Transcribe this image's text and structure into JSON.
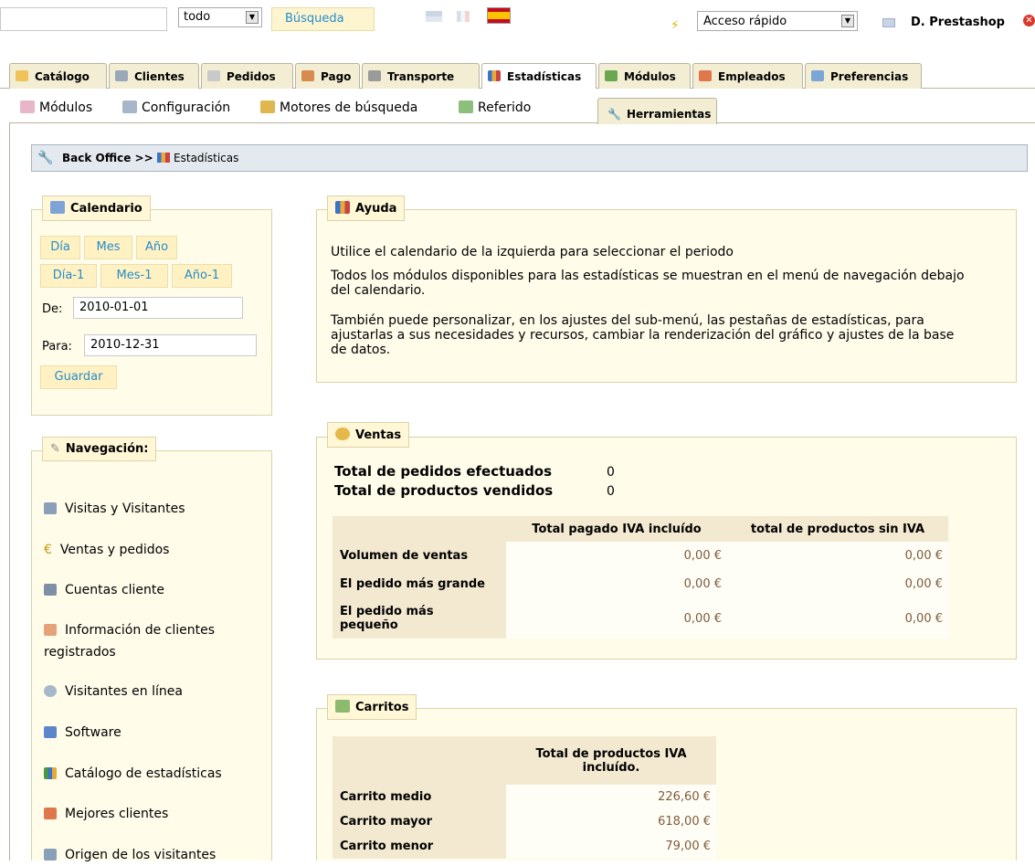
{
  "topbar": {
    "search_value": "",
    "search_scope": "todo",
    "search_button": "Búsqueda",
    "quick_access": "Acceso rápido",
    "user_name": "D. Prestashop"
  },
  "tabs": [
    {
      "label": "Catálogo"
    },
    {
      "label": "Clientes"
    },
    {
      "label": "Pedidos"
    },
    {
      "label": "Pago"
    },
    {
      "label": "Transporte"
    },
    {
      "label": "Estadísticas"
    },
    {
      "label": "Módulos"
    },
    {
      "label": "Empleados"
    },
    {
      "label": "Preferencias"
    },
    {
      "label": "Herramientas"
    }
  ],
  "subnav": [
    {
      "label": "Módulos"
    },
    {
      "label": "Configuración"
    },
    {
      "label": "Motores de búsqueda"
    },
    {
      "label": "Referido"
    }
  ],
  "breadcrumb": {
    "root": "Back Office",
    "sep": ">>",
    "current": "Estadísticas"
  },
  "calendar": {
    "legend": "Calendario",
    "buttons": [
      "Día",
      "Mes",
      "Año",
      "Día-1",
      "Mes-1",
      "Año-1"
    ],
    "from_label": "De:",
    "from_value": "2010-01-01",
    "to_label": "Para:",
    "to_value": "2010-12-31",
    "save": "Guardar"
  },
  "navigation": {
    "legend": "Navegación:",
    "items": [
      "Visitas y Visitantes",
      "Ventas y pedidos",
      "Cuentas cliente",
      "Información de clientes registrados",
      "Visitantes en línea",
      "Software",
      "Catálogo de estadísticas",
      "Mejores clientes",
      "Origen de los visitantes"
    ]
  },
  "help": {
    "legend": "Ayuda",
    "p1": "Utilice el calendario de la izquierda para seleccionar el periodo",
    "p2": "Todos los módulos disponibles para las estadísticas se muestran en el menú de navegación debajo del calendario.",
    "p3": "También puede personalizar, en los ajustes del sub-menú, las pestañas de estadísticas, para ajustarlas a sus necesidades y recursos, cambiar la renderización del gráfico y ajustes de la base de datos."
  },
  "sales": {
    "legend": "Ventas",
    "orders_label": "Total de pedidos efectuados",
    "orders_value": "0",
    "products_label": "Total de productos vendidos",
    "products_value": "0",
    "col1": "Total pagado IVA incluído",
    "col2": "total de productos sin IVA",
    "rows": [
      {
        "label": "Volumen de ventas",
        "v1": "0,00 €",
        "v2": "0,00 €"
      },
      {
        "label": "El pedido más grande",
        "v1": "0,00 €",
        "v2": "0,00 €"
      },
      {
        "label": "El pedido más pequeño",
        "v1": "0,00 €",
        "v2": "0,00 €"
      }
    ]
  },
  "carts": {
    "legend": "Carritos",
    "col": "Total de productos IVA incluído.",
    "rows": [
      {
        "label": "Carrito medio",
        "value": "226,60 €"
      },
      {
        "label": "Carrito mayor",
        "value": "618,00 €"
      },
      {
        "label": "Carrito menor",
        "value": "79,00 €"
      }
    ]
  }
}
